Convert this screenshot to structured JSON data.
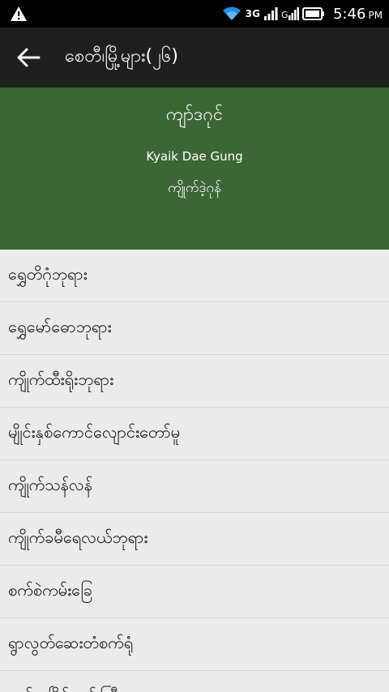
{
  "status_bar": {
    "network_label": "3G",
    "time": "5:46",
    "ampm": "PM"
  },
  "app_bar": {
    "title": "စေတီ၊မြို့များ(၂၆)"
  },
  "header": {
    "title_mm": "ကျာ်ဒဂုင်",
    "title_en": "Kyaik Dae Gung",
    "subtitle_mm": "ကျိုက်ဒဲ့ဂုန်"
  },
  "list": {
    "items": [
      "ရွှေတိဂုံဘုရား",
      "ရွှေမော်ဓောဘုရား",
      "ကျိုက်ထီးရိုးဘုရား",
      "မျိုင်းနှစ်ကောင်လျောင်းတော်မူ",
      "ကျိုက်သန်လန်",
      "ကျိုက်ခမီရေလယ်ဘုရား",
      "စက်စဲကမ်းခြေ",
      "ရွာလွတ်ဆေးတံစက်ရုံ",
      "မော်လမြိုင်ကျွန်းကြီး"
    ]
  },
  "icons": {
    "status_left": "warning-icon",
    "wifi": "wifi-icon",
    "signal": "signal-icon",
    "battery": "battery-icon",
    "back": "arrow-left-icon"
  },
  "colors": {
    "status_bar": "#000000",
    "app_bar": "#1f1f1f",
    "header": "#3b6736",
    "list_bg": "#ebebeb",
    "divider": "#d6d6d6"
  }
}
